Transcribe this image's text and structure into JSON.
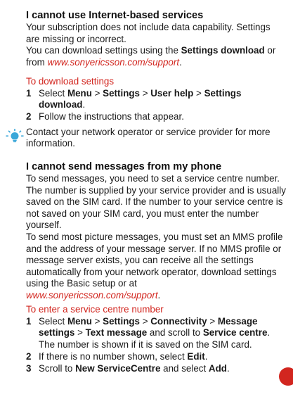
{
  "section1": {
    "title": "I cannot use Internet-based services",
    "para1": "Your subscription does not include data capability. Settings are missing or incorrect.",
    "para2": {
      "before": "You can download settings using the ",
      "bold": "Settings download",
      "middle": " or from ",
      "link": "www.sonyericsson.com/support",
      "after": "."
    },
    "subheading": "To download settings",
    "steps": [
      {
        "num": "1",
        "parts": [
          "Select ",
          "Menu",
          " > ",
          "Settings",
          " > ",
          "User help",
          " > ",
          "Settings download",
          "."
        ]
      },
      {
        "num": "2",
        "parts": [
          "Follow the instructions that appear."
        ]
      }
    ],
    "tip": "Contact your network operator or service provider for more information."
  },
  "section2": {
    "title": "I cannot send messages from my phone",
    "para1": "To send messages, you need to set a service centre number. The number is supplied by your service provider and is usually saved on the SIM card. If the number to your service centre is not saved on your SIM card, you must enter the number yourself.",
    "para2_text": "To send most picture messages, you must set an MMS profile and the address of your message server. If no MMS profile or message server exists, you can receive all the settings automatically from your network operator, download settings using the Basic setup or at",
    "para2_link": "www.sonyericsson.com/support",
    "para2_after": ".",
    "subheading": "To enter a service centre number",
    "steps": [
      {
        "num": "1",
        "parts": [
          "Select ",
          "Menu",
          " > ",
          "Settings",
          " > ",
          "Connectivity",
          " > ",
          "Message settings",
          " > ",
          "Text message",
          " and scroll to ",
          "Service centre",
          ". The number is shown if it is saved on the SIM card."
        ]
      },
      {
        "num": "2",
        "parts": [
          "If there is no number shown, select ",
          "Edit",
          "."
        ]
      },
      {
        "num": "3",
        "parts": [
          "Scroll to ",
          "New ServiceCentre",
          " and select ",
          "Add",
          "."
        ]
      }
    ]
  },
  "colors": {
    "accent": "#d2261f",
    "tip_icon": "#3aa7d9"
  },
  "icons": {
    "tip": "lightbulb-icon"
  }
}
